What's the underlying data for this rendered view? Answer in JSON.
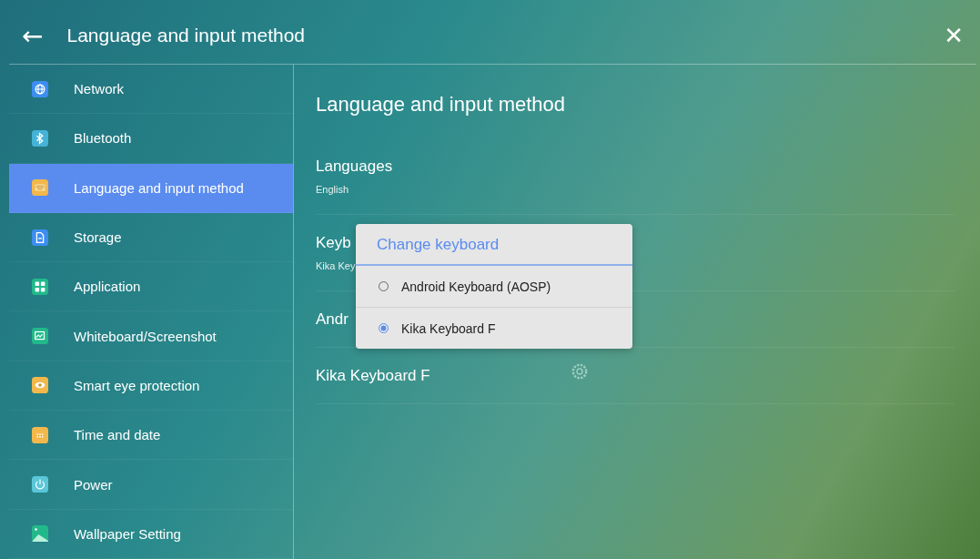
{
  "header": {
    "back": "←",
    "title": "Language and input method",
    "close": "✕"
  },
  "sidebar": {
    "items": [
      {
        "label": "Network",
        "kind": "globe",
        "color": "#3d8ef0",
        "selected": false
      },
      {
        "label": "Bluetooth",
        "kind": "bluetooth",
        "color": "#45b3d6",
        "selected": false
      },
      {
        "label": "Language and input method",
        "kind": "keyboard",
        "color": "#f2b84b",
        "selected": true
      },
      {
        "label": "Storage",
        "kind": "file",
        "color": "#3d8ef0",
        "selected": false
      },
      {
        "label": "Application",
        "kind": "grid",
        "color": "#22b98a",
        "selected": false
      },
      {
        "label": "Whiteboard/Screenshot",
        "kind": "chart",
        "color": "#22b98a",
        "selected": false
      },
      {
        "label": "Smart eye protection",
        "kind": "eye",
        "color": "#f2b84b",
        "selected": false
      },
      {
        "label": "Time and date",
        "kind": "calendar",
        "color": "#f2b84b",
        "selected": false
      },
      {
        "label": "Power",
        "kind": "power",
        "color": "#5bc6d8",
        "selected": false
      },
      {
        "label": "Wallpaper Setting",
        "kind": "landscape",
        "color": "#22b98a",
        "selected": false
      }
    ]
  },
  "content": {
    "title": "Language and input method",
    "rows": [
      {
        "title": "Languages",
        "summary": "English"
      },
      {
        "title": "Keyb",
        "summary": "Kika Key"
      },
      {
        "title": "Andr"
      },
      {
        "title": "Kika Keyboard F",
        "gear": true
      }
    ]
  },
  "dialog": {
    "title": "Change keyboard",
    "options": [
      {
        "label": "Android Keyboard (AOSP)",
        "selected": false
      },
      {
        "label": "Kika Keyboard F",
        "selected": true
      }
    ]
  }
}
